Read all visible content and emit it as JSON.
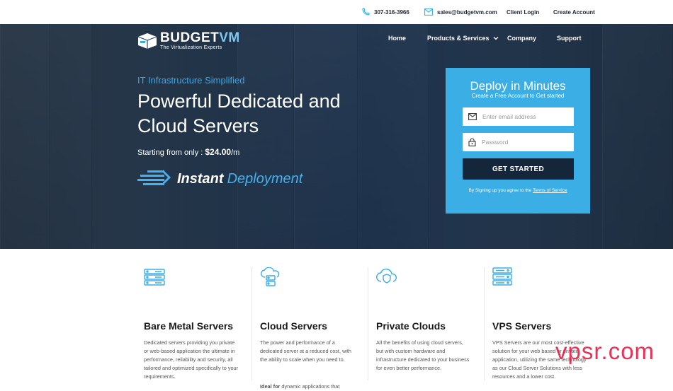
{
  "topbar": {
    "phone": "307-316-3966",
    "email": "sales@budgetvm.com",
    "client_login": "Client Login",
    "create_account": "Create Account"
  },
  "logo": {
    "brand_part1": "BUDGET",
    "brand_part2": "VM",
    "tagline": "The Virtualization Experts"
  },
  "nav": {
    "home": "Home",
    "products": "Products & Services",
    "company": "Company",
    "support": "Support"
  },
  "hero": {
    "eyebrow": "IT Infrastructure Simplified",
    "headline": "Powerful Dedicated and Cloud Servers",
    "price_prefix": "Starting from only : ",
    "price_value": "$24.00",
    "price_suffix": "/m",
    "instant_1": "Instant",
    "instant_2": "Deployment"
  },
  "signup": {
    "title": "Deploy in Minutes",
    "subtitle": "Create a Free Account to Get started",
    "email_placeholder": "Enter email address",
    "password_placeholder": "Password",
    "button": "GET STARTED",
    "terms_prefix": "By Signing up you agree to the ",
    "terms_link": "Terms of Service"
  },
  "features": [
    {
      "title": "Bare Metal Servers",
      "text": "Dedicated servers providing you private or web-based application the ultimate in performance, reliability and security, all tailored and optimized specifically to your requirements.",
      "icon": "server-stack-icon"
    },
    {
      "title": "Cloud Servers",
      "text": "The power and performance of a dedicated server at a reduced cost, with the ability to scale when you need to.",
      "extra_bold": "Ideal for",
      "extra_text": " dynamic applications that",
      "icon": "cloud-server-icon"
    },
    {
      "title": "Private Clouds",
      "text": "All the benefits of using cloud servers, but with custom hardware and infrastructure dedicated to your business for even better performance.",
      "icon": "cloud-shield-icon"
    },
    {
      "title": "VPS Servers",
      "text": "VPS Servers are our most cost-effective solution for your web based or private application, utilizing the same technology as our Cloud Server Solutions with less resources and a lower cost.",
      "icon": "vps-stack-icon"
    }
  ],
  "watermark": "vpsr.com",
  "colors": {
    "accent": "#3aaee5",
    "dark": "#15263a",
    "brand_light": "#7fc8f0"
  }
}
